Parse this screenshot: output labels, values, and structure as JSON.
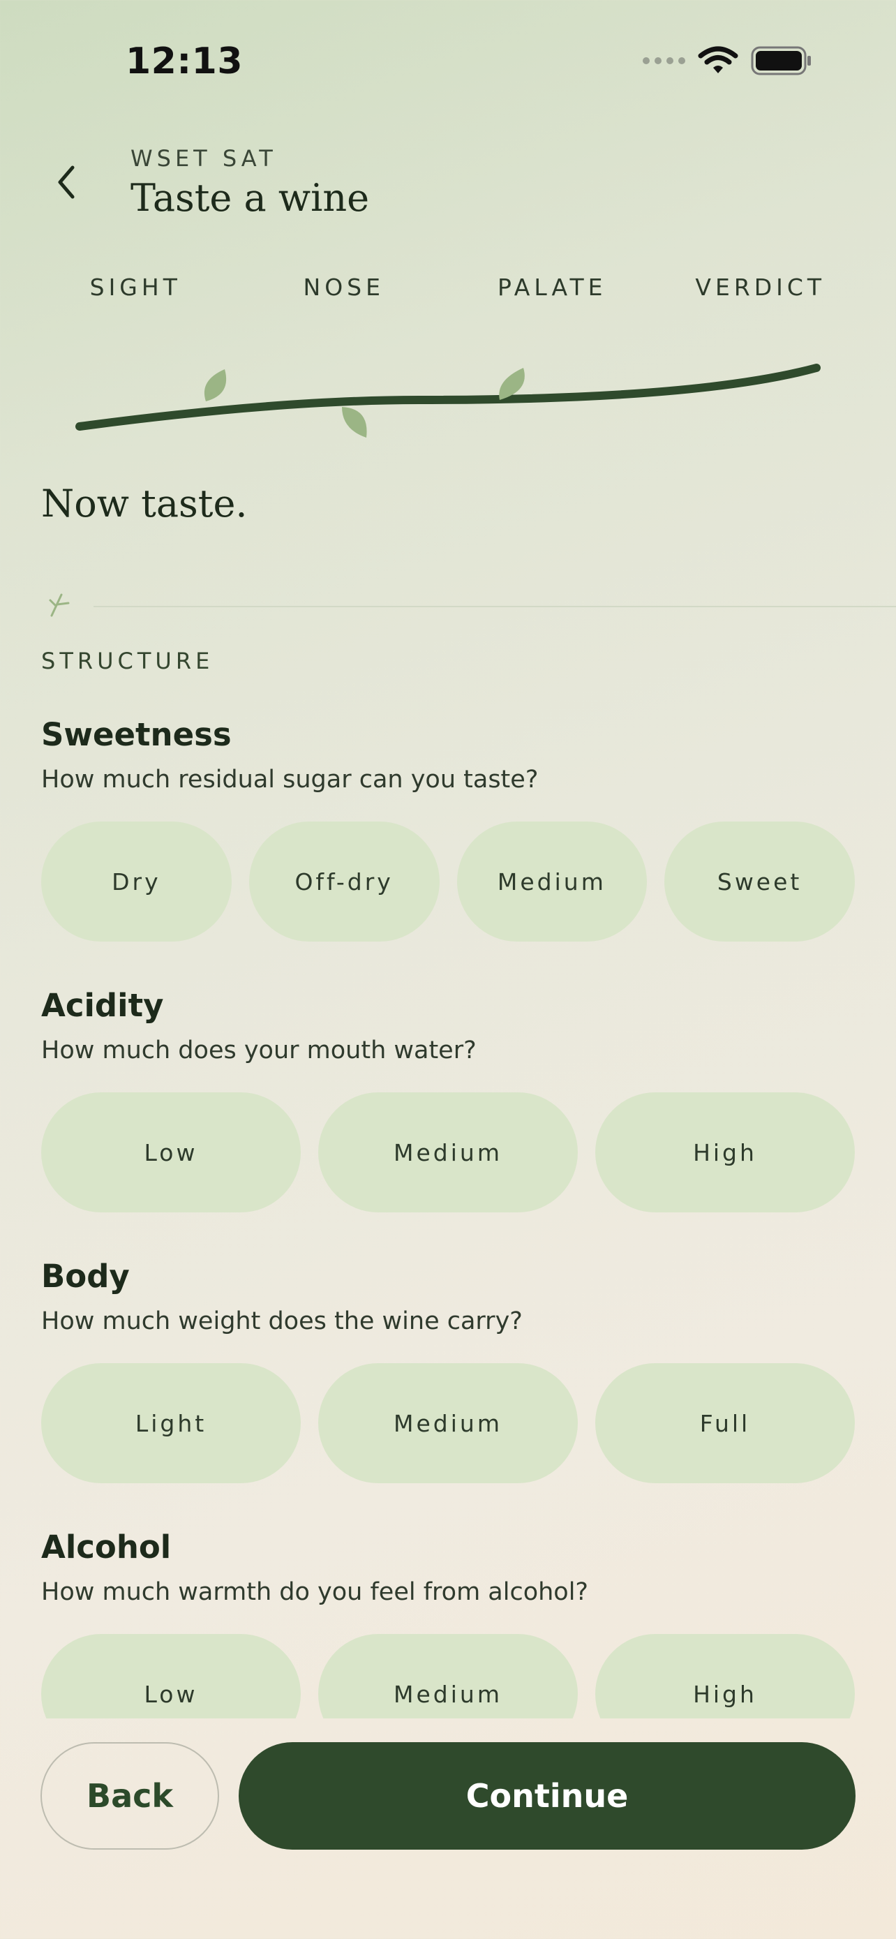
{
  "status_bar": {
    "time": "12:13"
  },
  "header": {
    "eyebrow": "WSET SAT",
    "title": "Taste a wine"
  },
  "steps": [
    "SIGHT",
    "NOSE",
    "PALATE",
    "VERDICT"
  ],
  "headline": "Now taste.",
  "section": {
    "label": "STRUCTURE"
  },
  "questions": [
    {
      "title": "Sweetness",
      "subtitle": "How much residual sugar can you taste?",
      "options": [
        "Dry",
        "Off-dry",
        "Medium",
        "Sweet"
      ]
    },
    {
      "title": "Acidity",
      "subtitle": "How much does your mouth water?",
      "options": [
        "Low",
        "Medium",
        "High"
      ]
    },
    {
      "title": "Body",
      "subtitle": "How much weight does the wine carry?",
      "options": [
        "Light",
        "Medium",
        "Full"
      ]
    },
    {
      "title": "Alcohol",
      "subtitle": "How much warmth do you feel from alcohol?",
      "options": [
        "Low",
        "Medium",
        "High"
      ]
    }
  ],
  "footer": {
    "back_label": "Back",
    "continue_label": "Continue"
  },
  "colors": {
    "accent": "#2f4a2c",
    "option_bg": "#d9e5c9",
    "leaf": "#9bb585"
  },
  "icons": [
    "chevron-left-icon",
    "wifi-icon",
    "battery-icon",
    "sprig-icon"
  ]
}
